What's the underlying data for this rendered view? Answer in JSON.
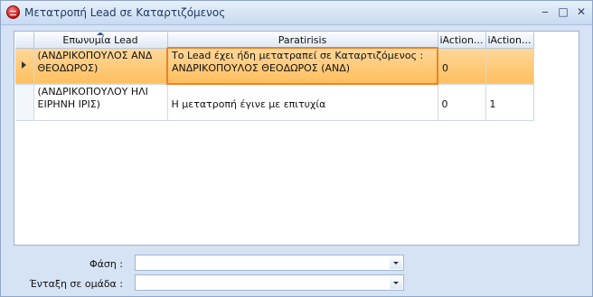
{
  "window": {
    "title": "Μετατροπή Lead σε  Καταρτιζόμενος"
  },
  "grid": {
    "columns": [
      "Επωνυμία Lead",
      "Paratirisis",
      "iAction...",
      "iAction..."
    ],
    "rows": [
      {
        "name": "(ΑΝΔΡΙΚΟΠΟΥΛΟΣ ΑΝΔ ΘΕΟΔΩΡΟΣ)",
        "note": "Το Lead έχει ήδη  μετατραπεί σε  Καταρτιζόμενος : ΑΝΔΡΙΚΟΠΟΥΛΟΣ ΘΕΟΔΩΡΟΣ (ΑΝΔ)",
        "a1": "0",
        "a2": ""
      },
      {
        "name": "(ΑΝΔΡΙΚΟΠΟΥΛΟΥ ΗΛΙ ΕΙΡΗΝΗ ΙΡΙΣ)",
        "note": "Η μετατροπή έγινε με επιτυχία",
        "a1": "0",
        "a2": "1"
      }
    ]
  },
  "form": {
    "phase_label": "Φάση :",
    "phase_value": "",
    "group_label": "Ένταξη σε ομάδα :",
    "group_value": ""
  }
}
